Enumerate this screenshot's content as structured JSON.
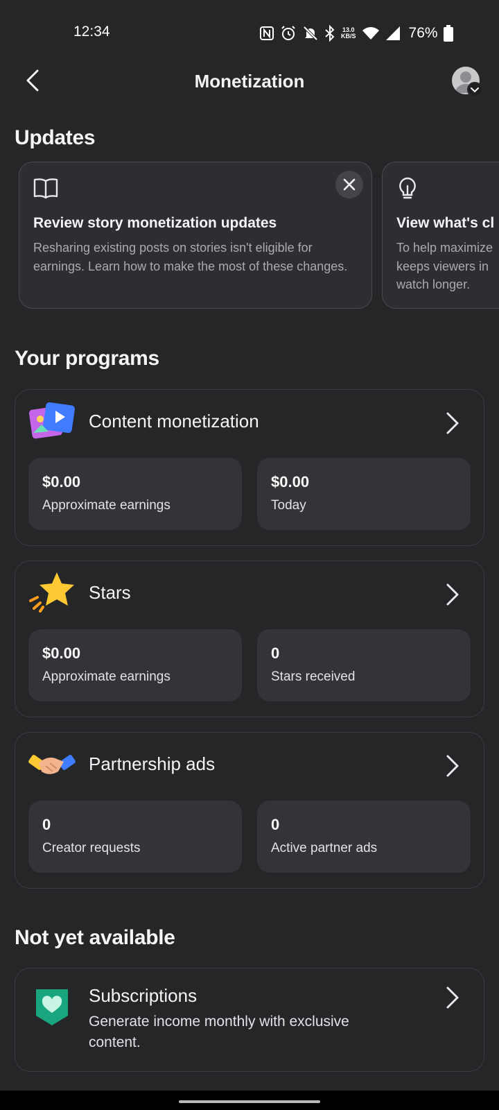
{
  "status_bar": {
    "time": "12:34",
    "net_speed_top": "13.0",
    "net_speed_bottom": "KB/S",
    "battery": "76%"
  },
  "header": {
    "title": "Monetization",
    "back_icon": "chevron-left-icon",
    "avatar_icon": "profile-avatar-icon"
  },
  "updates": {
    "title": "Updates",
    "cards": [
      {
        "icon": "book-icon",
        "title": "Review story monetization updates",
        "body": "Resharing existing posts on stories isn't eligible for earnings. Learn how to make the most of these changes."
      },
      {
        "icon": "lightbulb-icon",
        "title": "View what's cl",
        "body": "To help maximize keeps viewers in watch longer."
      }
    ]
  },
  "programs": {
    "title": "Your programs",
    "items": [
      {
        "title": "Content monetization",
        "icon": "content-monetization-icon",
        "stats": [
          {
            "value": "$0.00",
            "label": "Approximate earnings"
          },
          {
            "value": "$0.00",
            "label": "Today"
          }
        ]
      },
      {
        "title": "Stars",
        "icon": "star-icon",
        "stats": [
          {
            "value": "$0.00",
            "label": "Approximate earnings"
          },
          {
            "value": "0",
            "label": "Stars received"
          }
        ]
      },
      {
        "title": "Partnership ads",
        "icon": "handshake-icon",
        "stats": [
          {
            "value": "0",
            "label": "Creator requests"
          },
          {
            "value": "0",
            "label": "Active partner ads"
          }
        ]
      }
    ]
  },
  "not_available": {
    "title": "Not yet available",
    "items": [
      {
        "title": "Subscriptions",
        "description": "Generate income monthly with exclusive content.",
        "icon": "subscription-heart-icon"
      }
    ]
  },
  "colors": {
    "background": "#252628",
    "card_stat": "#333437",
    "border": "#3a3b3f",
    "text_primary": "#f4f5f7",
    "text_secondary": "#a9abb0"
  }
}
